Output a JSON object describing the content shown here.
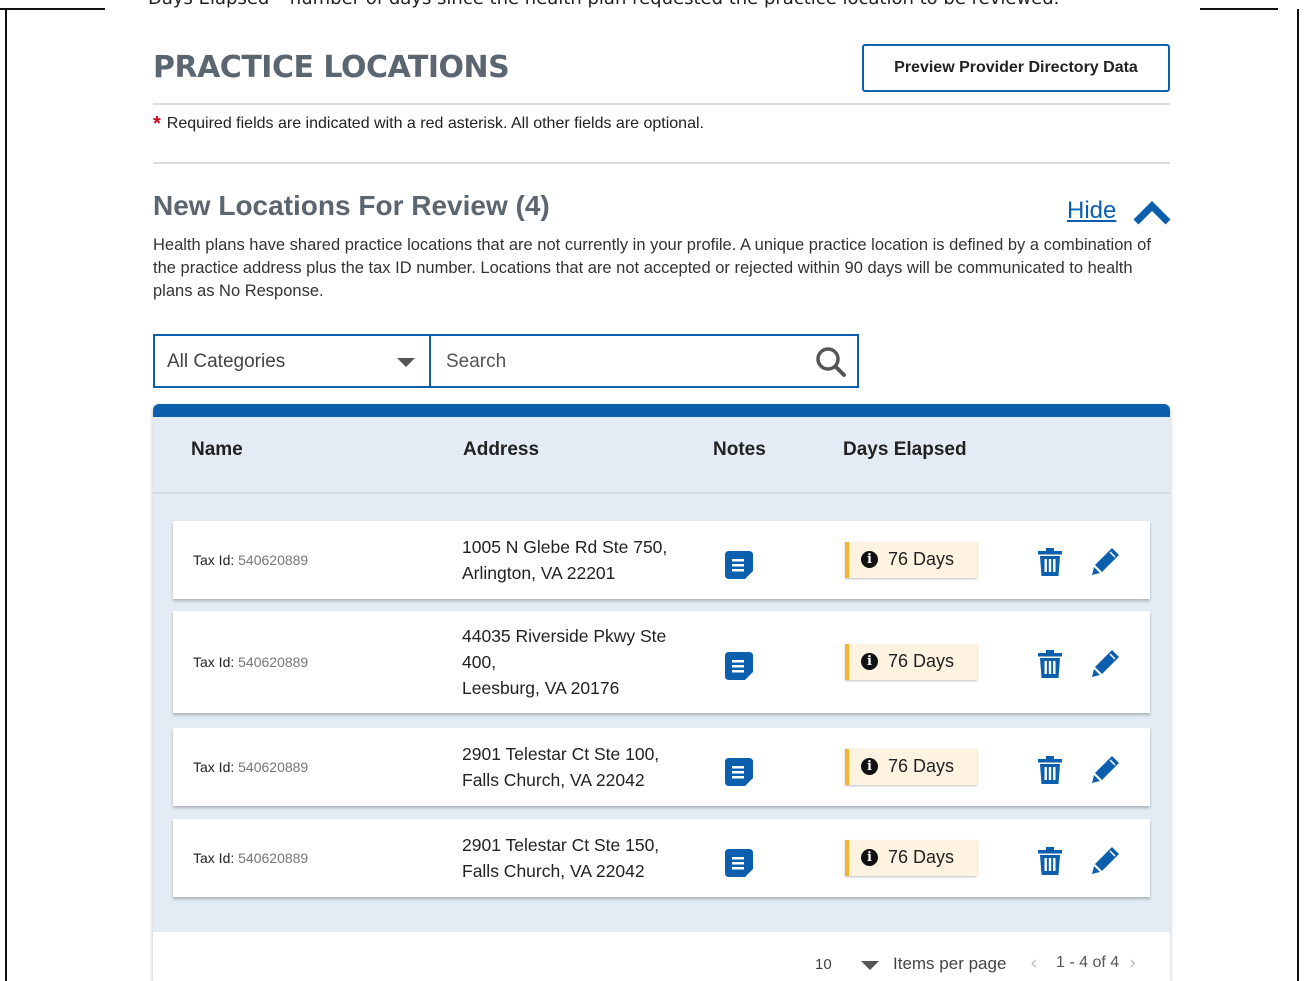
{
  "caption_clipped": "Days Elapsed – number of days since the health plan requested the practice location to be reviewed.",
  "page": {
    "title": "PRACTICE LOCATIONS",
    "preview_button": "Preview Provider Directory Data",
    "required_note": "Required fields are indicated with a red asterisk. All other fields are optional.",
    "required_star": "*"
  },
  "section": {
    "title": "New Locations For Review (4)",
    "hide_label": "Hide",
    "description": "Health plans have shared practice locations that are not currently in your profile. A unique practice location is defined by a combination of the practice address plus the tax ID number. Locations that are not accepted or rejected within 90 days will be communicated to health plans as No Response."
  },
  "filters": {
    "category_selected": "All Categories",
    "search_placeholder": "Search"
  },
  "table": {
    "headers": {
      "name": "Name",
      "address": "Address",
      "notes": "Notes",
      "days": "Days Elapsed"
    },
    "rows": [
      {
        "tax_label": "Tax Id:",
        "tax_id": "540620889",
        "address_lines": [
          "1005 N Glebe Rd Ste 750,",
          "Arlington, VA 22201"
        ],
        "days": "76 Days"
      },
      {
        "tax_label": "Tax Id:",
        "tax_id": "540620889",
        "address_lines": [
          "44035 Riverside Pkwy Ste",
          "400,",
          "Leesburg, VA 20176"
        ],
        "days": "76 Days"
      },
      {
        "tax_label": "Tax Id:",
        "tax_id": "540620889",
        "address_lines": [
          "2901 Telestar Ct Ste 100,",
          "Falls Church, VA 22042"
        ],
        "days": "76 Days"
      },
      {
        "tax_label": "Tax Id:",
        "tax_id": "540620889",
        "address_lines": [
          "2901 Telestar Ct Ste 150,",
          "Falls Church, VA 22042"
        ],
        "days": "76 Days"
      }
    ]
  },
  "pagination": {
    "page_size": "10",
    "items_per_page_label": "Items per page",
    "range": "1 - 4 of 4",
    "prev": "‹",
    "next": "›"
  },
  "icons": {
    "chevron_up": "chevron-up-icon",
    "search": "search-icon",
    "notes": "note-icon",
    "info": "info-icon",
    "trash": "trash-icon",
    "edit": "pencil-icon"
  },
  "colors": {
    "primary": "#0b5fad",
    "title_gray": "#5b6670",
    "required_red": "#d0021b",
    "badge_bg": "#fdf3e0",
    "badge_accent": "#f3b330",
    "table_bg": "#e3ecf4"
  }
}
